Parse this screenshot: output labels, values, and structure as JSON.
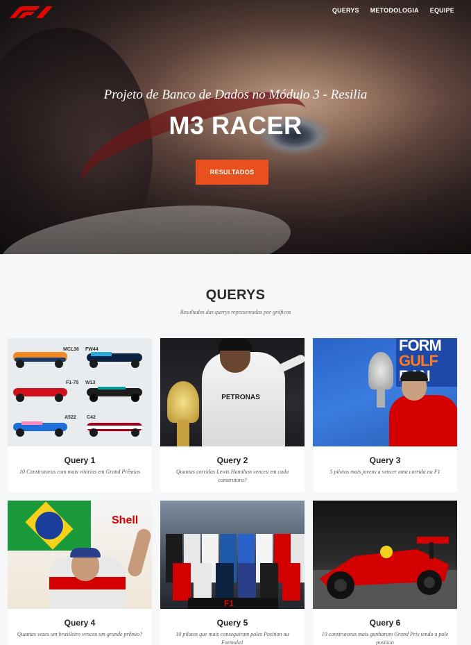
{
  "nav": {
    "logo": "F1",
    "items": [
      "QUERYS",
      "METODOLOGIA",
      "EQUIPE"
    ]
  },
  "hero": {
    "subtitle": "Projeto de Banco de Dados no Módulo 3 - Resilia",
    "title": "M3 RACER",
    "button": "RESULTADOS"
  },
  "section": {
    "title": "QUERYS",
    "subtitle": "Resultados das querys representadas por gráficos"
  },
  "cards": [
    {
      "title": "Query 1",
      "desc": "10 Construtoras com mais vitórias em Grand Prêmios",
      "car_labels": [
        "MCL36",
        "FW44",
        "F1-75",
        "W13",
        "A522",
        "C42"
      ]
    },
    {
      "title": "Query 2",
      "desc": "Quantas corridas Lewis Hamilton venceu em cada construtora?",
      "shirt_text": "PETRONAS"
    },
    {
      "title": "Query 3",
      "desc": "5 pilotos mais jovens a vencer uma corrida na F1",
      "banner_text": [
        "FORM",
        "GULF",
        "RAN"
      ]
    },
    {
      "title": "Query 4",
      "desc": "Quantas vezes um brasileiro venceu um grande prêmio?",
      "sponsor_text": "Shell"
    },
    {
      "title": "Query 5",
      "desc": "10 pilotos que mais conseguiram poles Position na Formula1",
      "logo_text": "F1"
    },
    {
      "title": "Query 6",
      "desc": "10 construtoras mais ganharam Grand Prix tendo a pole position"
    }
  ],
  "colors": {
    "accent": "#e8501e",
    "f1_red": "#e10600",
    "background": "#f6f7f9"
  }
}
